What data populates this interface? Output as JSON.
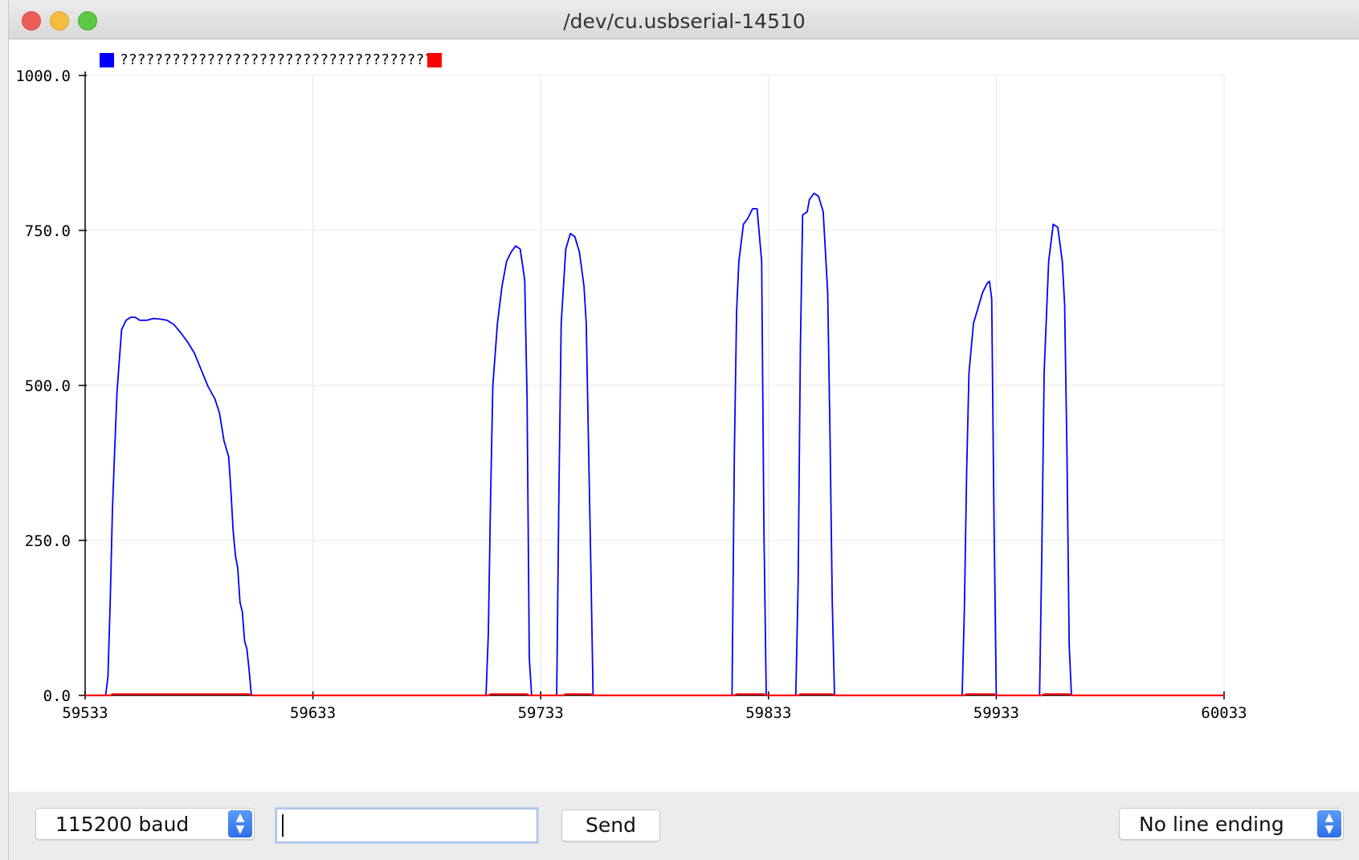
{
  "window": {
    "title": "/dev/cu.usbserial-14510"
  },
  "bottom_bar": {
    "baud_label": "115200 baud",
    "message_input_value": "",
    "send_label": "Send",
    "line_ending_label": "No line ending"
  },
  "icons": {
    "select_stepper": "up-down-chevron-icon",
    "window_controls": [
      "close-icon",
      "minimize-icon",
      "maximize-icon"
    ]
  },
  "chart_data": {
    "type": "line",
    "title": "",
    "xlabel": "",
    "ylabel": "",
    "xlim": [
      59533,
      60033
    ],
    "ylim": [
      0,
      1000
    ],
    "x_ticks": [
      "59533",
      "59633",
      "59733",
      "59833",
      "59933",
      "60033"
    ],
    "y_ticks": [
      "0.0",
      "250.0",
      "500.0",
      "750.0",
      "1000.0"
    ],
    "grid": true,
    "legend_position": "top-left",
    "series": [
      {
        "name": "????????????????????????????????????0",
        "color": "#0000ff",
        "points": [
          [
            59533,
            0
          ],
          [
            59542,
            0
          ],
          [
            59543,
            30
          ],
          [
            59544,
            150
          ],
          [
            59545,
            300
          ],
          [
            59546,
            400
          ],
          [
            59547,
            490
          ],
          [
            59549,
            590
          ],
          [
            59551,
            605
          ],
          [
            59553,
            610
          ],
          [
            59555,
            610
          ],
          [
            59557,
            605
          ],
          [
            59560,
            605
          ],
          [
            59563,
            608
          ],
          [
            59566,
            607
          ],
          [
            59569,
            605
          ],
          [
            59572,
            598
          ],
          [
            59575,
            585
          ],
          [
            59578,
            570
          ],
          [
            59581,
            552
          ],
          [
            59584,
            525
          ],
          [
            59587,
            498
          ],
          [
            59590,
            478
          ],
          [
            59592,
            455
          ],
          [
            59594,
            410
          ],
          [
            59596,
            385
          ],
          [
            59597,
            330
          ],
          [
            59598,
            265
          ],
          [
            59599,
            225
          ],
          [
            59600,
            205
          ],
          [
            59601,
            150
          ],
          [
            59602,
            135
          ],
          [
            59603,
            88
          ],
          [
            59604,
            75
          ],
          [
            59605,
            40
          ],
          [
            59606,
            0
          ],
          [
            59709,
            0
          ],
          [
            59710,
            100
          ],
          [
            59711,
            320
          ],
          [
            59712,
            500
          ],
          [
            59714,
            600
          ],
          [
            59716,
            660
          ],
          [
            59718,
            700
          ],
          [
            59720,
            715
          ],
          [
            59722,
            725
          ],
          [
            59724,
            720
          ],
          [
            59726,
            670
          ],
          [
            59727,
            480
          ],
          [
            59728,
            60
          ],
          [
            59729,
            0
          ],
          [
            59740,
            0
          ],
          [
            59741,
            330
          ],
          [
            59742,
            600
          ],
          [
            59744,
            720
          ],
          [
            59746,
            745
          ],
          [
            59748,
            740
          ],
          [
            59750,
            715
          ],
          [
            59752,
            660
          ],
          [
            59753,
            600
          ],
          [
            59754,
            400
          ],
          [
            59755,
            210
          ],
          [
            59756,
            0
          ],
          [
            59817,
            0
          ],
          [
            59818,
            390
          ],
          [
            59819,
            620
          ],
          [
            59820,
            700
          ],
          [
            59822,
            760
          ],
          [
            59824,
            770
          ],
          [
            59826,
            785
          ],
          [
            59828,
            785
          ],
          [
            59830,
            700
          ],
          [
            59831,
            270
          ],
          [
            59832,
            0
          ],
          [
            59845,
            0
          ],
          [
            59846,
            180
          ],
          [
            59847,
            560
          ],
          [
            59848,
            775
          ],
          [
            59850,
            780
          ],
          [
            59851,
            800
          ],
          [
            59853,
            810
          ],
          [
            59855,
            805
          ],
          [
            59857,
            780
          ],
          [
            59859,
            650
          ],
          [
            59860,
            420
          ],
          [
            59861,
            150
          ],
          [
            59862,
            0
          ],
          [
            59918,
            0
          ],
          [
            59919,
            140
          ],
          [
            59920,
            360
          ],
          [
            59921,
            520
          ],
          [
            59923,
            600
          ],
          [
            59925,
            625
          ],
          [
            59927,
            650
          ],
          [
            59929,
            665
          ],
          [
            59930,
            668
          ],
          [
            59931,
            640
          ],
          [
            59932,
            280
          ],
          [
            59933,
            0
          ],
          [
            59952,
            0
          ],
          [
            59953,
            230
          ],
          [
            59954,
            520
          ],
          [
            59956,
            700
          ],
          [
            59958,
            760
          ],
          [
            59960,
            755
          ],
          [
            59962,
            700
          ],
          [
            59963,
            630
          ],
          [
            59964,
            400
          ],
          [
            59965,
            80
          ],
          [
            59966,
            0
          ],
          [
            60033,
            0
          ]
        ]
      },
      {
        "name": "",
        "color": "#ff0000",
        "points": [
          [
            59533,
            0
          ],
          [
            59544,
            0
          ],
          [
            59545,
            2
          ],
          [
            59605,
            2
          ],
          [
            59606,
            0
          ],
          [
            59710,
            0
          ],
          [
            59711,
            2
          ],
          [
            59727,
            2
          ],
          [
            59728,
            0
          ],
          [
            59743,
            0
          ],
          [
            59744,
            2
          ],
          [
            59755,
            2
          ],
          [
            59756,
            0
          ],
          [
            59818,
            0
          ],
          [
            59819,
            2
          ],
          [
            59831,
            2
          ],
          [
            59832,
            0
          ],
          [
            59846,
            0
          ],
          [
            59847,
            2
          ],
          [
            59861,
            2
          ],
          [
            59862,
            0
          ],
          [
            59919,
            0
          ],
          [
            59920,
            2
          ],
          [
            59932,
            2
          ],
          [
            59933,
            0
          ],
          [
            59953,
            0
          ],
          [
            59954,
            2
          ],
          [
            59965,
            2
          ],
          [
            59966,
            0
          ],
          [
            60033,
            0
          ]
        ]
      }
    ]
  }
}
